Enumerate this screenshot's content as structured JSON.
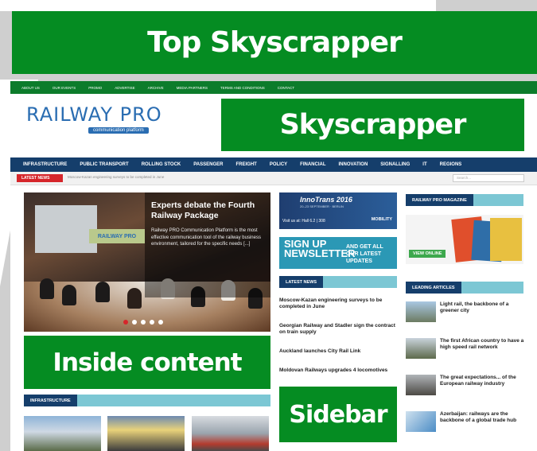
{
  "top_banner": "Top Skyscrapper",
  "top_nav": [
    "ABOUT US",
    "OUR EVENTS",
    "PROMO",
    "ADVERTISE",
    "ARCHIVE",
    "MEDIA PARTNERS",
    "TERMS AND CONDITIONS",
    "CONTACT"
  ],
  "logo": {
    "word": "RAILWAY PRO",
    "sub": "communication platform"
  },
  "skyscrapper": "Skyscrapper",
  "main_nav": [
    "INFRASTRUCTURE",
    "PUBLIC TRANSPORT",
    "ROLLING STOCK",
    "PASSENGER",
    "FREIGHT",
    "POLICY",
    "FINANCIAL",
    "INNOVATION",
    "SIGNALLING",
    "IT",
    "REGIONS"
  ],
  "ticker": {
    "label": "LATEST NEWS",
    "text": "Moscow-Kazan engineering surveys to be completed in June"
  },
  "search": {
    "placeholder": "Search..."
  },
  "slider": {
    "title": "Experts debate the Fourth Railway Package",
    "description": "Railway PRO Communication Platform is the most effective communication tool of the railway business environment, tailored for the specific needs [...]",
    "banner": "RAILWAY PRO"
  },
  "inside_content": "Inside content",
  "infrastructure_heading": "INFRASTRUCTURE",
  "ad_innotrans": {
    "title": "InnoTrans 2016",
    "dates": "20–23 SEPTEMBER · BERLIN",
    "visit": "Visit us at: Hall 6.2 | 308",
    "tagline": "MOBILITY"
  },
  "ad_signup": {
    "left": "SIGN UP NEWSLETTER",
    "right": "AND GET ALL OUR LATEST UPDATES"
  },
  "latest_news_heading": "LATEST NEWS",
  "latest_news": [
    {
      "title": "Moscow-Kazan engineering surveys to be completed in June"
    },
    {
      "title": "Georgian Railway and Stadler sign the contract on train supply"
    },
    {
      "title": "Auckland launches City Rail Link"
    },
    {
      "title": "Moldovan Railways upgrades 4 locomotives"
    }
  ],
  "sidebar": "Sidebar",
  "magazine_heading": "RAILWAY PRO MAGAZINE",
  "magazine_button": "VIEW ONLINE",
  "leading_heading": "LEADING ARTICLES",
  "leading_articles": [
    {
      "title": "Light rail, the backbone of a greener city"
    },
    {
      "title": "The first African country to have a high speed rail network"
    },
    {
      "title": "The great expectations... of the European railway industry"
    },
    {
      "title": "Azerbaijan: railways are the backbone of a global trade hub"
    }
  ],
  "colors": {
    "green": "#058c22",
    "navy": "#153e6b",
    "teal": "#7cc7d4",
    "red": "#d6262b"
  }
}
